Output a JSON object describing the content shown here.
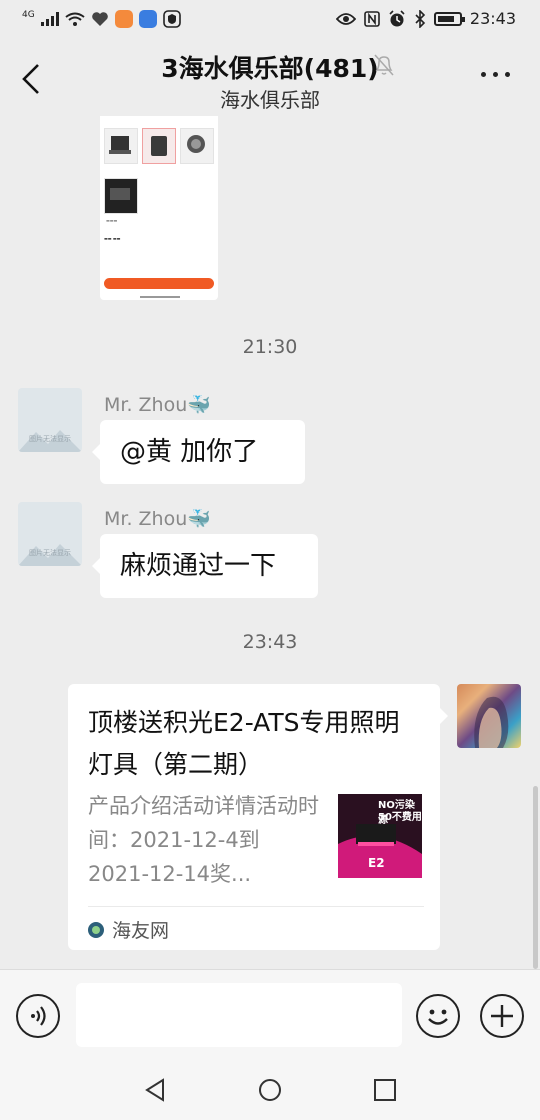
{
  "status_bar": {
    "network": "4G",
    "time": "23:43"
  },
  "header": {
    "title": "3海水俱乐部(481)",
    "subtitle": "海水俱乐部"
  },
  "messages": [
    {
      "type": "time",
      "text": "21:30"
    },
    {
      "type": "text",
      "sender": "Mr. Zhou🐳",
      "text": "@黄  加你了",
      "avatar_caption": "图片无法显示"
    },
    {
      "type": "text",
      "sender": "Mr. Zhou🐳",
      "text": "麻烦通过一下",
      "avatar_caption": "图片无法显示"
    },
    {
      "type": "time",
      "text": "23:43"
    }
  ],
  "card": {
    "title": "顶楼送积光E2-ATS专用照明灯具（第二期）",
    "description": "产品介绍活动详情活动时间：2021-12-4到2021-12-14奖...",
    "source": "海友网",
    "thumb_text_1": "NO污染源",
    "thumb_text_2": "50不费用",
    "thumb_text_3": "E2"
  },
  "colors": {
    "background": "#ededed",
    "bubble": "#ffffff",
    "accent_orange": "#f05a24"
  },
  "icons": {
    "voice": "voice-icon",
    "emoji": "emoji-icon",
    "plus": "plus-icon",
    "back": "back-arrow-icon",
    "mute": "muted-bell-icon",
    "more": "more-icon"
  }
}
